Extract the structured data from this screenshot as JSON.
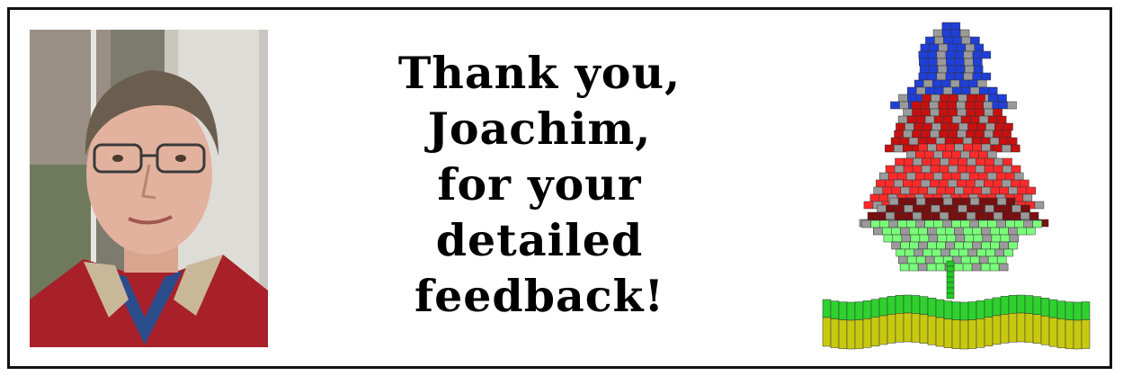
{
  "message": {
    "lines": [
      "Thank you,",
      "Joachim,",
      "for your",
      "detailed",
      "feedback!"
    ]
  },
  "photo": {
    "icon": "portrait-photo"
  },
  "tree": {
    "icon": "christmas-tree-chart",
    "colors": {
      "top": "#1f3fd8",
      "upper": "#c81010",
      "middle": "#ff2a2a",
      "lower": "#7aff7a",
      "trunk": "#22cc22",
      "ground_top": "#2ed12e",
      "ground_bottom": "#c8c810"
    }
  },
  "frame_color": "#111111"
}
